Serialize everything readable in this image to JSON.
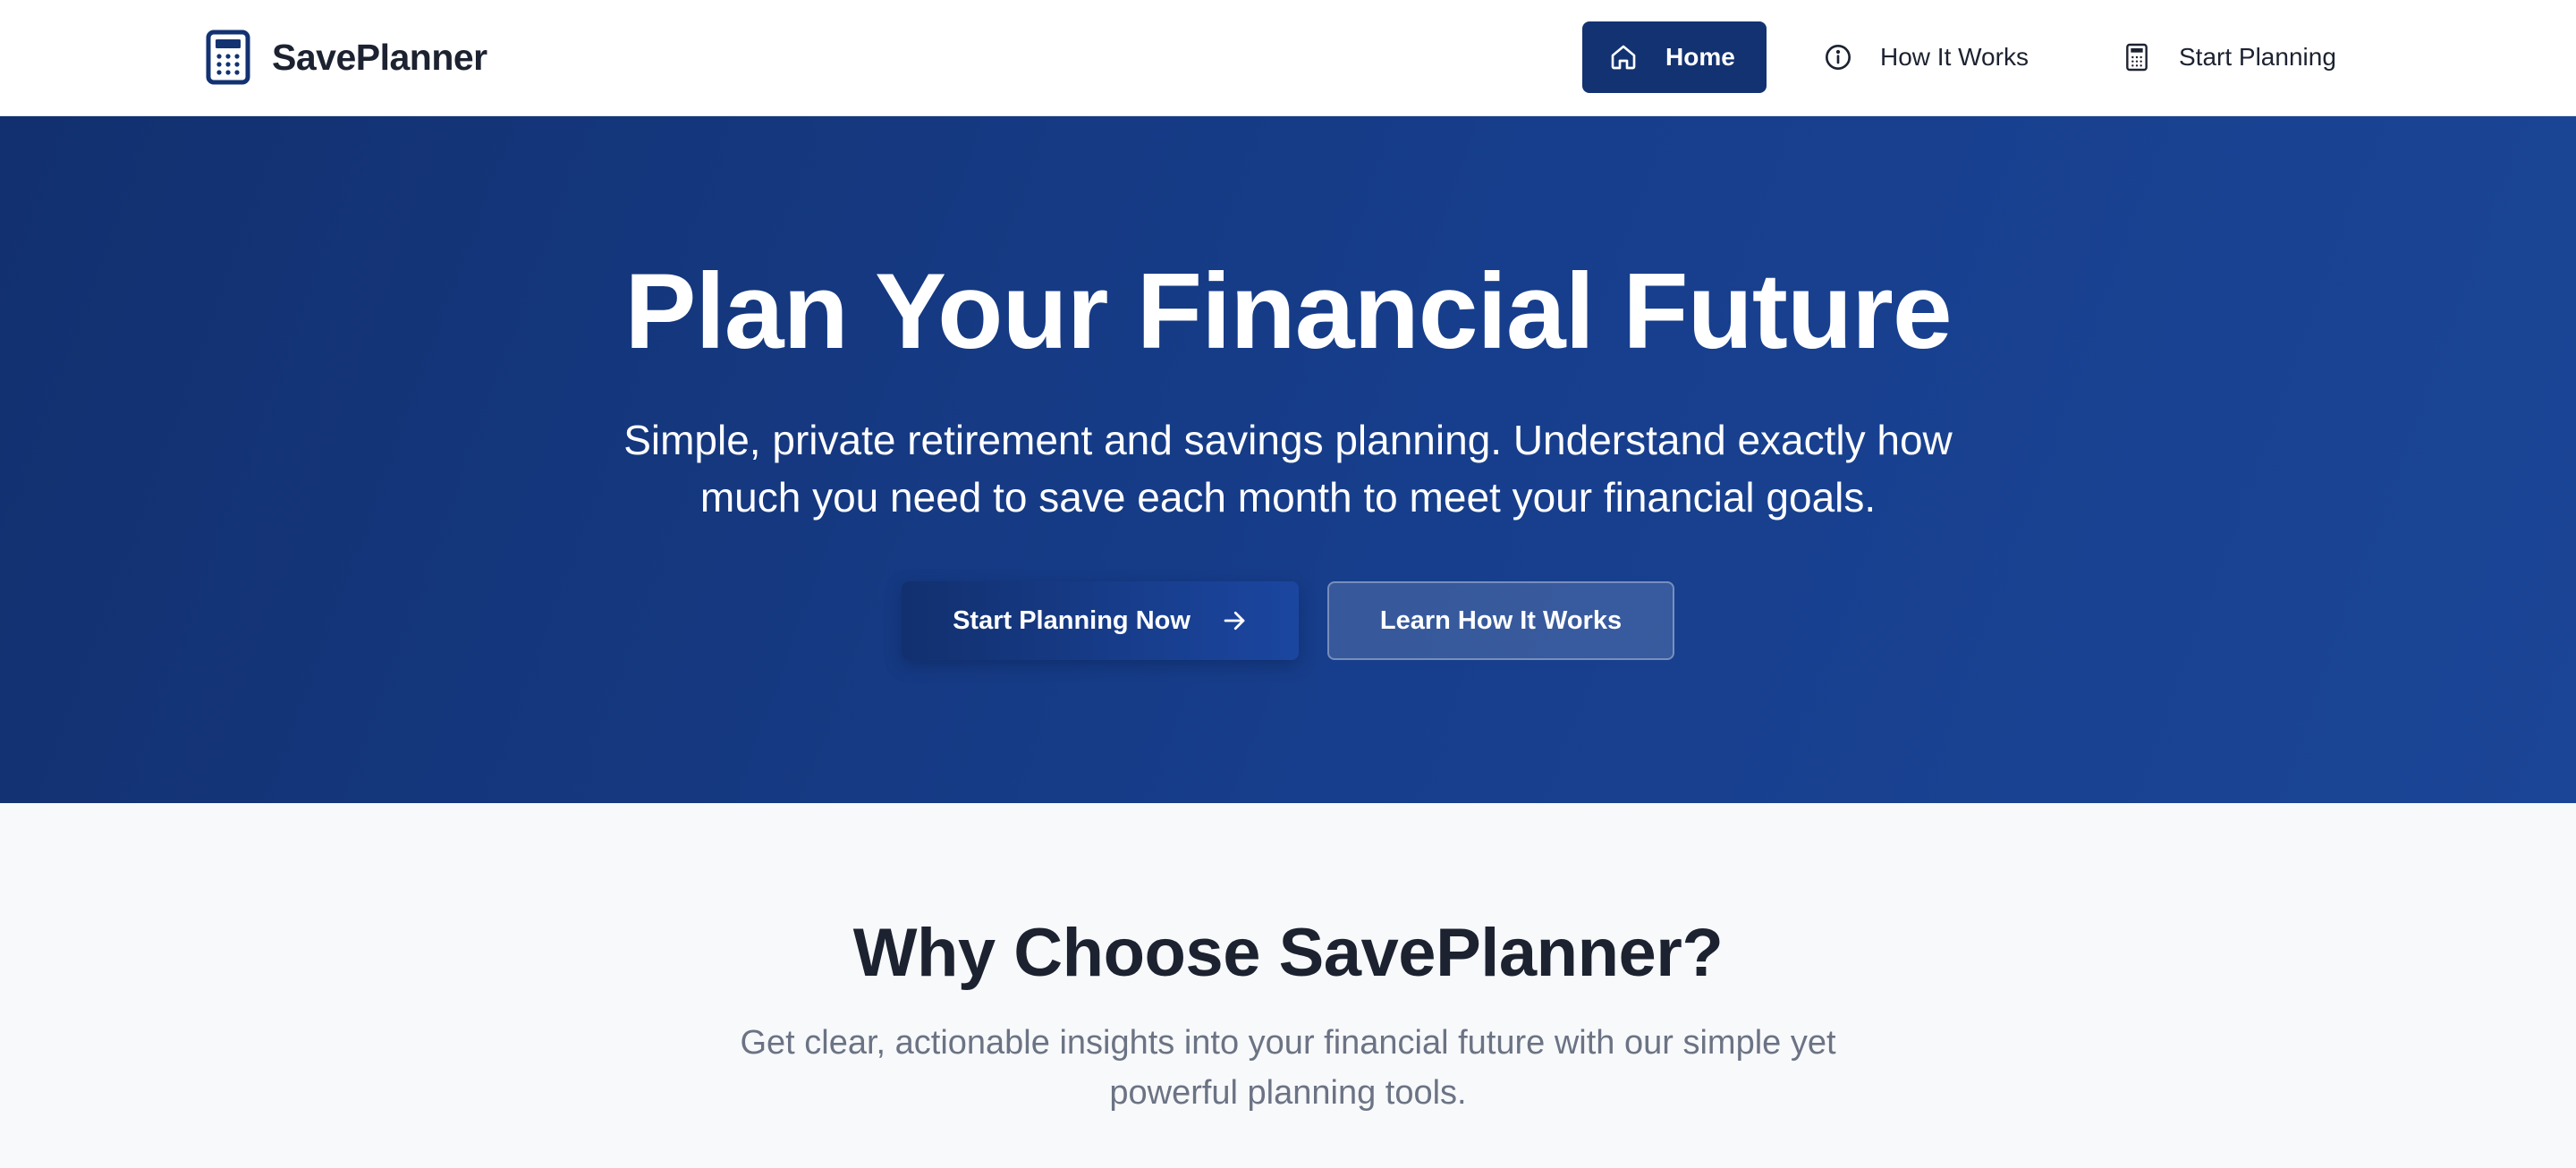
{
  "nav": {
    "brand": "SavePlanner",
    "brand_icon": "calculator-icon",
    "items": [
      {
        "label": "Home",
        "icon": "home-icon",
        "active": true
      },
      {
        "label": "How It Works",
        "icon": "info-icon",
        "active": false
      },
      {
        "label": "Start Planning",
        "icon": "calculator-icon",
        "active": false
      }
    ]
  },
  "hero": {
    "title": "Plan Your Financial Future",
    "subtitle": "Simple, private retirement and savings planning. Understand exactly how much you need to save each month to meet your financial goals.",
    "primary_button": "Start Planning Now",
    "primary_button_icon": "arrow-right-icon",
    "secondary_button": "Learn How It Works"
  },
  "why": {
    "title": "Why Choose SavePlanner?",
    "subtitle": "Get clear, actionable insights into your financial future with our simple yet powerful planning tools."
  },
  "colors": {
    "brand": "#133272",
    "hero_start": "#12306f",
    "hero_end": "#1b4596",
    "muted_text": "#6b7384",
    "heading_text": "#1c2230"
  }
}
